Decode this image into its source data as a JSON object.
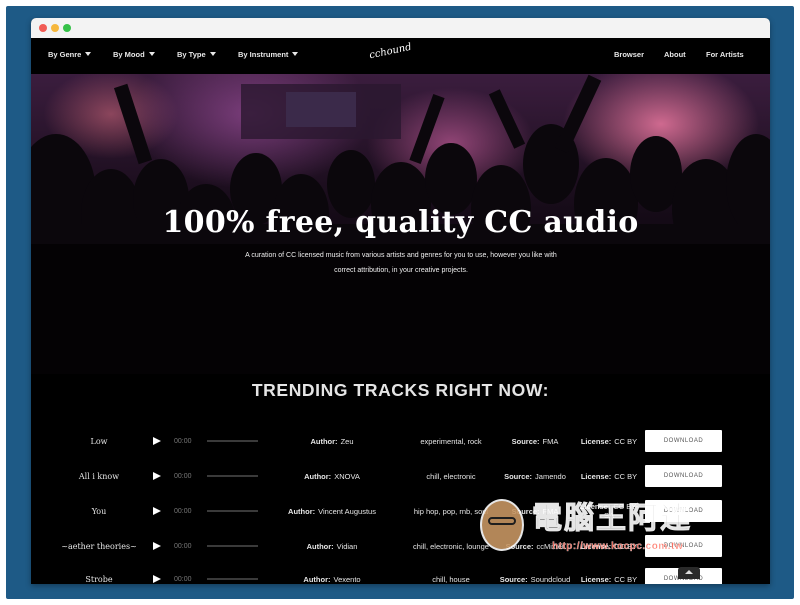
{
  "nav": {
    "left_items": [
      {
        "label": "By Genre"
      },
      {
        "label": "By Mood"
      },
      {
        "label": "By Type"
      },
      {
        "label": "By Instrument"
      }
    ],
    "logo": "cchound",
    "right_items": [
      {
        "label": "Browser"
      },
      {
        "label": "About"
      },
      {
        "label": "For Artists"
      }
    ]
  },
  "hero": {
    "title": "100% free, quality CC audio",
    "subtitle": "A curation of CC licensed music from various artists and genres for you to use, however you like with correct attribution, in your creative projects."
  },
  "trending": {
    "heading": "TRENDING TRACKS RIGHT NOW:",
    "author_label": "Author:",
    "source_label": "Source:",
    "license_label": "License:",
    "tracks": [
      {
        "title": "Low",
        "time": "00:00",
        "author": "Zeu",
        "tags": "experimental, rock",
        "source": "FMA",
        "license": "CC BY",
        "download": "DOWNLOAD"
      },
      {
        "title": "All i know",
        "time": "00:00",
        "author": "XNOVA",
        "tags": "chill, electronic",
        "source": "Jamendo",
        "license": "CC BY",
        "download": "DOWNLOAD"
      },
      {
        "title": "You",
        "time": "00:00",
        "author": "Vincent Augustus",
        "tags": "hip hop, pop, rnb, soul",
        "source": "FMA",
        "license": "CC BY-SA",
        "download": "DOWNLOAD"
      },
      {
        "title": "~aether theories~",
        "time": "00:00",
        "author": "Vidian",
        "tags": "chill, electronic, lounge",
        "source": "ccMixter",
        "license": "CC BY",
        "download": "DOWNLOAD"
      },
      {
        "title": "Strobe",
        "time": "00:00",
        "author": "Vexento",
        "tags": "chill, house",
        "source": "Soundcloud",
        "license": "CC BY",
        "download": "DOWNLOAD"
      }
    ]
  },
  "watermark": {
    "text": "電腦王阿達",
    "url": "http://www.kocpc.com.tw"
  },
  "colors": {
    "frame": "#1e5a86",
    "page_bg": "#000000",
    "button_bg": "#ffffff"
  },
  "icons": [
    "play-icon",
    "caret-down-icon",
    "chevron-up-icon"
  ]
}
